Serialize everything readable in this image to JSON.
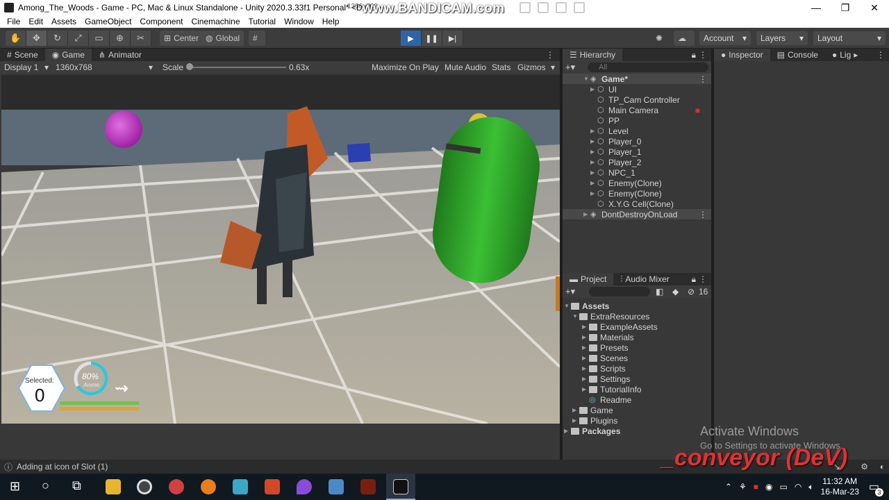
{
  "window": {
    "title": "Among_The_Woods - Game - PC, Mac & Linux Standalone - Unity 2020.3.33f1 Personal* <DX11>",
    "title_overlay": "1356x768",
    "recorder_label": "www.BANDICAM.com",
    "minimize": "—",
    "maximize": "❐",
    "close": "✕"
  },
  "menu": [
    "File",
    "Edit",
    "Assets",
    "GameObject",
    "Component",
    "Cinemachine",
    "Tutorial",
    "Window",
    "Help"
  ],
  "toolbar": {
    "tools": [
      "hand-icon",
      "move-icon",
      "rotate-icon",
      "scale-icon",
      "rect-icon",
      "transform-icon",
      "custom-tool-icon"
    ],
    "pivot_label": "Center",
    "space_label": "Global",
    "account_label": "Account",
    "layers_label": "Layers",
    "layout_label": "Layout"
  },
  "left_tabs": {
    "scene": "Scene",
    "game": "Game",
    "animator": "Animator"
  },
  "game_toolbar": {
    "display": "Display 1",
    "resolution": "1360x768",
    "scale_label": "Scale",
    "scale_value": "0.63x",
    "maximize": "Maximize On Play",
    "mute": "Mute Audio",
    "stats": "Stats",
    "gizmos": "Gizmos"
  },
  "hud": {
    "selected_label": "Selected:",
    "selected_value": "0",
    "ammo_percent": "80%",
    "ammo_label": "Ammo"
  },
  "hierarchy": {
    "tab": "Hierarchy",
    "search_placeholder": "All",
    "scene_name": "Game*",
    "items": [
      "UI",
      "TP_Cam Controller",
      "Main Camera",
      "PP",
      "Level",
      "Player_0",
      "Player_1",
      "Player_2",
      "NPC_1",
      "Enemy(Clone)",
      "Enemy(Clone)",
      "X.Y.G Cell(Clone)"
    ],
    "dont_destroy": "DontDestroyOnLoad"
  },
  "right_tabs": {
    "inspector": "Inspector",
    "console": "Console",
    "lighting": "Lig"
  },
  "project": {
    "tab": "Project",
    "audio_mixer": "Audio Mixer",
    "hidden_count": "16",
    "tree": {
      "assets": "Assets",
      "extra": "ExtraResources",
      "children": [
        "ExampleAssets",
        "Materials",
        "Presets",
        "Scenes",
        "Scripts",
        "Settings",
        "TutorialInfo"
      ],
      "readme": "Readme",
      "game": "Game",
      "plugins": "Plugins",
      "packages": "Packages"
    }
  },
  "status": "Adding at icon of Slot (1)",
  "activate": {
    "title": "Activate Windows",
    "sub": "Go to Settings to activate Windows."
  },
  "watermark": "_conveyor (DeV)",
  "clock": {
    "time": "11:32 AM",
    "date": "16-Mar-23"
  },
  "notif_count": "3",
  "colors": {
    "play_active": "#2f65a8",
    "panel_bg": "#383838",
    "floor": "#a09e98",
    "capsule_green": "#2ea82a",
    "blob_magenta": "#c83bc8"
  }
}
